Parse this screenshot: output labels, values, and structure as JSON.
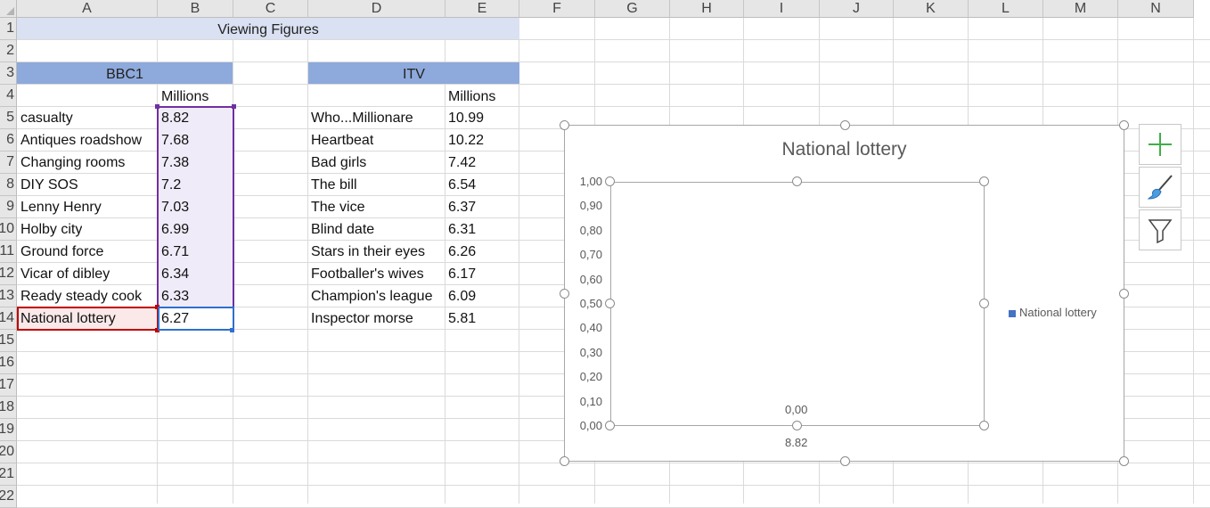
{
  "columns": [
    "A",
    "B",
    "C",
    "D",
    "E",
    "F",
    "G",
    "H",
    "I",
    "J",
    "K",
    "L",
    "M",
    "N"
  ],
  "rows": [
    "1",
    "2",
    "3",
    "4",
    "5",
    "6",
    "7",
    "8",
    "9",
    "10",
    "11",
    "12",
    "13",
    "14",
    "15",
    "16",
    "17",
    "18",
    "19",
    "20",
    "21",
    "22"
  ],
  "title": "Viewing Figures",
  "bbc": {
    "header": "BBC1",
    "unit": "Millions",
    "items": [
      {
        "name": "casualty",
        "value": "8.82"
      },
      {
        "name": "Antiques roadshow",
        "value": "7.68"
      },
      {
        "name": "Changing rooms",
        "value": "7.38"
      },
      {
        "name": "DIY SOS",
        "value": "7.2"
      },
      {
        "name": "Lenny Henry",
        "value": "7.03"
      },
      {
        "name": "Holby city",
        "value": "6.99"
      },
      {
        "name": "Ground force",
        "value": "6.71"
      },
      {
        "name": "Vicar of dibley",
        "value": "6.34"
      },
      {
        "name": "Ready steady cook",
        "value": "6.33"
      },
      {
        "name": "National lottery",
        "value": "6.27"
      }
    ]
  },
  "itv": {
    "header": "ITV",
    "unit": "Millions",
    "items": [
      {
        "name": "Who...Millionare",
        "value": "10.99"
      },
      {
        "name": "Heartbeat",
        "value": "10.22"
      },
      {
        "name": "Bad girls",
        "value": "7.42"
      },
      {
        "name": "The bill",
        "value": "6.54"
      },
      {
        "name": "The vice",
        "value": "6.37"
      },
      {
        "name": "Blind date",
        "value": "6.31"
      },
      {
        "name": "Stars in their eyes",
        "value": "6.26"
      },
      {
        "name": "Footballer's wives",
        "value": "6.17"
      },
      {
        "name": "Champion's league",
        "value": "6.09"
      },
      {
        "name": "Inspector morse",
        "value": "5.81"
      }
    ]
  },
  "colors": {
    "title_fill": "#d9e1f2",
    "header_fill": "#8ea9db",
    "selection_fill": "#f0ebf8",
    "selection_border": "#7030a0",
    "name_range_border": "#c00000",
    "name_range_fill": "#fbe9e9",
    "value_range_border": "#2f6fcd",
    "series": "#4472c4",
    "plus_icon": "#3fae49"
  },
  "chart": {
    "title": "National lottery",
    "y_ticks": [
      "1,00",
      "0,90",
      "0,80",
      "0,70",
      "0,60",
      "0,50",
      "0,40",
      "0,30",
      "0,20",
      "0,10",
      "0,00"
    ],
    "data_label": "0,00",
    "x_label": "8.82",
    "legend": "National lottery"
  },
  "chart_data": {
    "type": "bar",
    "title": "National lottery",
    "categories": [
      "8.82"
    ],
    "series": [
      {
        "name": "National lottery",
        "values": [
          0
        ]
      }
    ],
    "ylim": [
      0,
      1
    ],
    "y_ticks": [
      "1,00",
      "0,90",
      "0,80",
      "0,70",
      "0,60",
      "0,50",
      "0,40",
      "0,30",
      "0,20",
      "0,10",
      "0,00"
    ],
    "grid": false,
    "legend_position": "right",
    "data_labels": [
      "0,00"
    ]
  }
}
